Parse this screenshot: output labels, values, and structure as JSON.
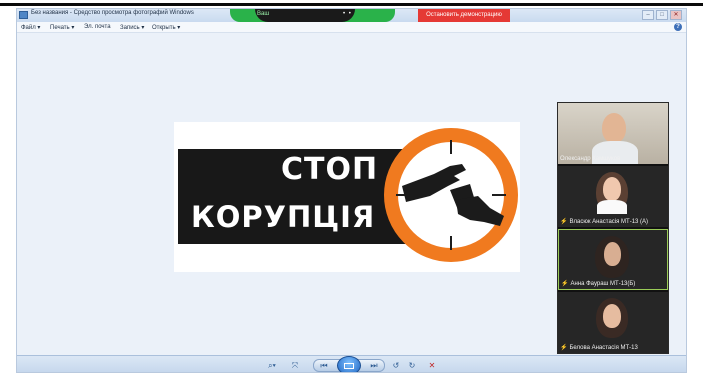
{
  "window": {
    "title": "Без названия - Средство просмотра фотографий Windows",
    "buttons": [
      "–",
      "□",
      "✕"
    ]
  },
  "meeting_bar": {
    "id_text": "Ваш",
    "dots": "• •",
    "stop_demo_label": "Остановить демонстрацию"
  },
  "menu": {
    "items": [
      "Файл ▾",
      "Печать ▾",
      "Эл. почта",
      "Запись ▾",
      "Открыть ▾"
    ],
    "help": "?"
  },
  "image": {
    "line1": "СТОП",
    "line2": "КОРУПЦІЯ",
    "colors": {
      "ring": "#f07a1f",
      "band": "#181818"
    }
  },
  "participants": [
    {
      "name": "Олександр Камшуков",
      "muted": false,
      "active": false
    },
    {
      "name": "Власюк Анастасія МТ-13 (А)",
      "muted": true,
      "active": false
    },
    {
      "name": "Анна Фаураш МТ-13(Б)",
      "muted": true,
      "active": true
    },
    {
      "name": "Белова Анастасія МТ-13",
      "muted": true,
      "active": false
    }
  ],
  "toolbar": {
    "zoom": "⌕▾",
    "fit": "⤧",
    "prev": "⏮",
    "next": "⏭",
    "rotate_left": "↺",
    "rotate_right": "↻",
    "delete": "✕"
  }
}
